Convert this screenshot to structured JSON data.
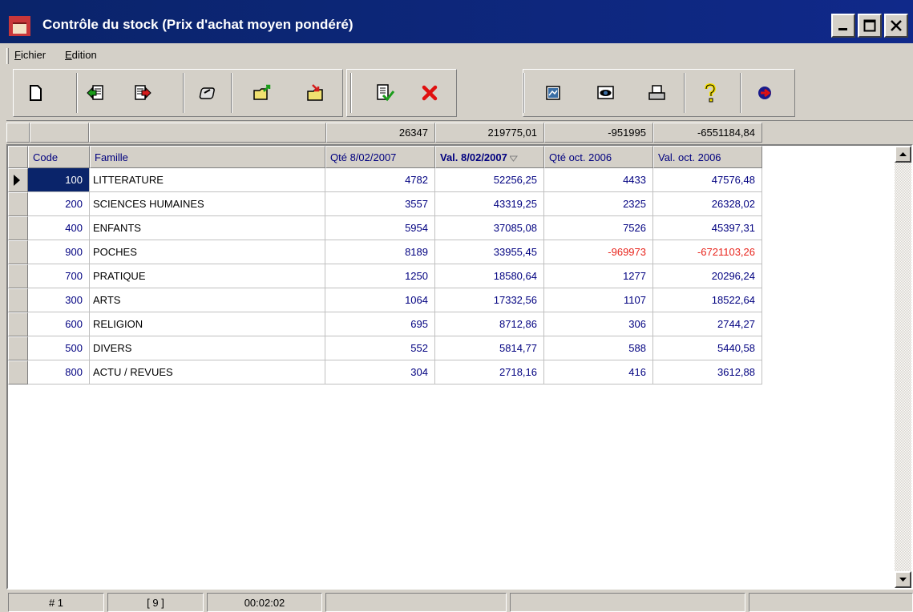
{
  "window": {
    "title": "Contrôle du stock (Prix d'achat moyen pondéré)",
    "title_bar_color": "#0a246a",
    "controls": [
      "minimize-icon",
      "maximize-icon",
      "close-icon"
    ]
  },
  "menu": {
    "items": [
      {
        "label": "Fichier",
        "accel": "F",
        "rest": "ichier"
      },
      {
        "label": "Edition",
        "accel": "E",
        "rest": "dition"
      }
    ]
  },
  "toolbar": {
    "icons": [
      "new-icon",
      "import-icon",
      "export-icon",
      "edit-icon",
      "open-folder-icon",
      "folder-export-icon",
      "validate-icon",
      "delete-icon",
      "image-icon",
      "preview-icon",
      "print-icon",
      "help-icon",
      "exit-icon"
    ]
  },
  "totals": {
    "qte_current": "26347",
    "val_current": "219775,01",
    "qte_previous": "-951995",
    "val_previous": "-6551184,84"
  },
  "grid": {
    "columns": [
      "Code",
      "Famille",
      "Qté 8/02/2007",
      "Val. 8/02/2007",
      "Qté oct. 2006",
      "Val. oct. 2006"
    ],
    "sorted_column": "Val. 8/02/2007",
    "rows": [
      {
        "code": "100",
        "famille": "LITTERATURE",
        "qte_cur": "4782",
        "val_cur": "52256,25",
        "qte_prev": "4433",
        "val_prev": "47576,48"
      },
      {
        "code": "200",
        "famille": "SCIENCES HUMAINES",
        "qte_cur": "3557",
        "val_cur": "43319,25",
        "qte_prev": "2325",
        "val_prev": "26328,02"
      },
      {
        "code": "400",
        "famille": "ENFANTS",
        "qte_cur": "5954",
        "val_cur": "37085,08",
        "qte_prev": "7526",
        "val_prev": "45397,31"
      },
      {
        "code": "900",
        "famille": "POCHES",
        "qte_cur": "8189",
        "val_cur": "33955,45",
        "qte_prev": "-969973",
        "val_prev": "-6721103,26"
      },
      {
        "code": "700",
        "famille": "PRATIQUE",
        "qte_cur": "1250",
        "val_cur": "18580,64",
        "qte_prev": "1277",
        "val_prev": "20296,24"
      },
      {
        "code": "300",
        "famille": "ARTS",
        "qte_cur": "1064",
        "val_cur": "17332,56",
        "qte_prev": "1107",
        "val_prev": "18522,64"
      },
      {
        "code": "600",
        "famille": "RELIGION",
        "qte_cur": "695",
        "val_cur": "8712,86",
        "qte_prev": "306",
        "val_prev": "2744,27"
      },
      {
        "code": "500",
        "famille": "DIVERS",
        "qte_cur": "552",
        "val_cur": "5814,77",
        "qte_prev": "588",
        "val_prev": "5440,58"
      },
      {
        "code": "800",
        "famille": "ACTU / REVUES",
        "qte_cur": "304",
        "val_cur": "2718,16",
        "qte_prev": "416",
        "val_prev": "3612,88"
      }
    ],
    "value_color": "#000080",
    "negative_color": "#e8241c"
  },
  "status": {
    "record": "# 1",
    "count": "[ 9 ]",
    "time": "00:02:02"
  }
}
